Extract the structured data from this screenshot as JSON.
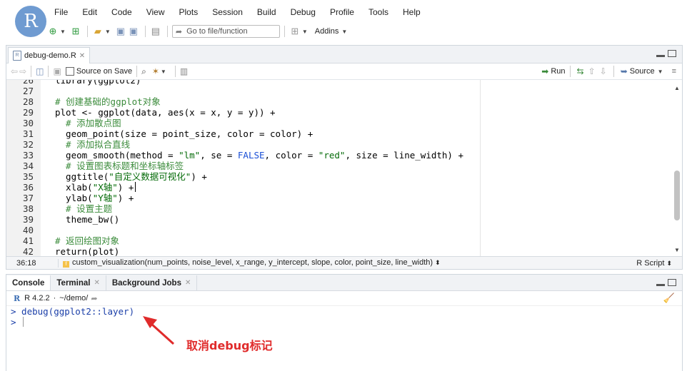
{
  "app": {
    "logo_letter": "R"
  },
  "menu": [
    "File",
    "Edit",
    "Code",
    "View",
    "Plots",
    "Session",
    "Build",
    "Debug",
    "Profile",
    "Tools",
    "Help"
  ],
  "toolbar": {
    "goto_placeholder": "Go to file/function",
    "addins_label": "Addins"
  },
  "editor": {
    "tab_name": "debug-demo.R",
    "source_on_save_label": "Source on Save",
    "run_label": "Run",
    "source_label": "Source",
    "lines": [
      {
        "n": "26",
        "t": "library(ggplot2)"
      },
      {
        "n": "27",
        "t": ""
      },
      {
        "n": "28",
        "t": "# 创建基础的ggplot对象"
      },
      {
        "n": "29",
        "t": "plot <- ggplot(data, aes(x = x, y = y)) +"
      },
      {
        "n": "30",
        "t": "  # 添加散点图"
      },
      {
        "n": "31",
        "t": "  geom_point(size = point_size, color = color) +"
      },
      {
        "n": "32",
        "t": "  # 添加拟合直线"
      },
      {
        "n": "33",
        "t": "  geom_smooth(method = \"lm\", se = FALSE, color = \"red\", size = line_width) +"
      },
      {
        "n": "34",
        "t": "  # 设置图表标题和坐标轴标签"
      },
      {
        "n": "35",
        "t": "  ggtitle(\"自定义数据可视化\") +"
      },
      {
        "n": "36",
        "t": "  xlab(\"X轴\") +"
      },
      {
        "n": "37",
        "t": "  ylab(\"Y轴\") +"
      },
      {
        "n": "38",
        "t": "  # 设置主题"
      },
      {
        "n": "39",
        "t": "  theme_bw()"
      },
      {
        "n": "40",
        "t": ""
      },
      {
        "n": "41",
        "t": "# 返回绘图对象"
      },
      {
        "n": "42",
        "t": "return(plot)"
      }
    ],
    "status_position": "36:18",
    "status_function": "custom_visualization(num_points, noise_level, x_range, y_intercept, slope, color, point_size, line_width)",
    "status_language": "R Script"
  },
  "console": {
    "tabs": [
      {
        "label": "Console",
        "active": true
      },
      {
        "label": "Terminal",
        "active": false
      },
      {
        "label": "Background Jobs",
        "active": false
      }
    ],
    "r_version": "R 4.2.2",
    "working_dir": "~/demo/",
    "lines": [
      "> debug(ggplot2::layer)",
      "> "
    ]
  },
  "annotation": {
    "text": "取消debug标记",
    "color": "#e02b2b"
  }
}
